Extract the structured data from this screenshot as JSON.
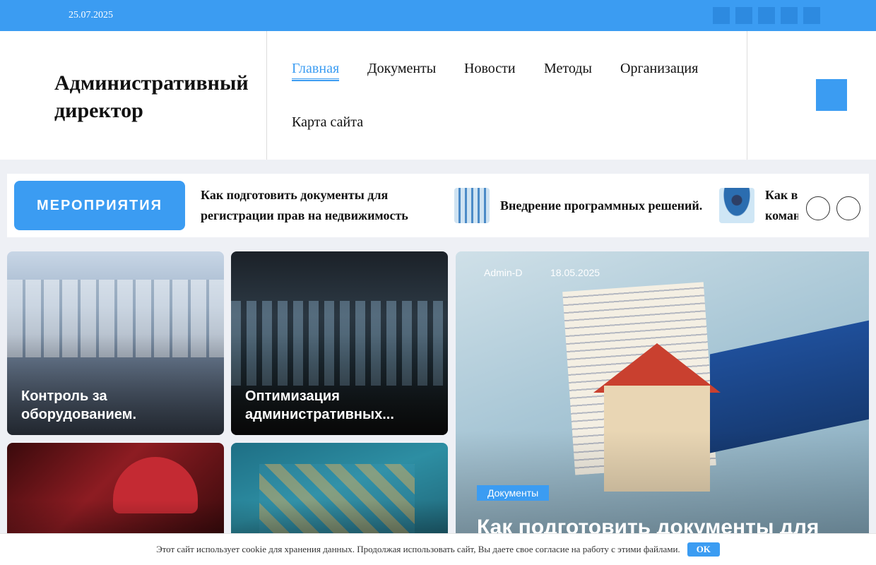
{
  "topbar": {
    "date": "25.07.2025",
    "social_icons": [
      "social-icon-1",
      "social-icon-2",
      "social-icon-3",
      "social-icon-4",
      "social-icon-5"
    ]
  },
  "header": {
    "logo": "Административный директор",
    "nav": [
      {
        "label": "Главная",
        "active": true
      },
      {
        "label": "Документы"
      },
      {
        "label": "Новости"
      },
      {
        "label": "Методы"
      },
      {
        "label": "Организация"
      },
      {
        "label": "Карта сайта"
      }
    ],
    "accent_color": "#3b9cf2"
  },
  "events": {
    "label": "МЕРОПРИЯТИЯ",
    "items": [
      {
        "title": "Как подготовить документы для регистрации прав на недвижимость"
      },
      {
        "title": "Внедрение программных решений."
      },
      {
        "title": "Как в команде"
      }
    ]
  },
  "cards": [
    {
      "title": "Контроль за оборудованием."
    },
    {
      "title": "Оптимизация административных..."
    },
    {
      "title": ""
    },
    {
      "title": ""
    }
  ],
  "feature": {
    "author": "Admin-D",
    "date": "18.05.2025",
    "category": "Документы",
    "title": "Как подготовить документы для"
  },
  "cookie": {
    "text": "Этот сайт использует cookie для хранения данных. Продолжая использовать сайт, Вы даете свое согласие на работу с этими файлами.",
    "ok_label": "OK"
  }
}
